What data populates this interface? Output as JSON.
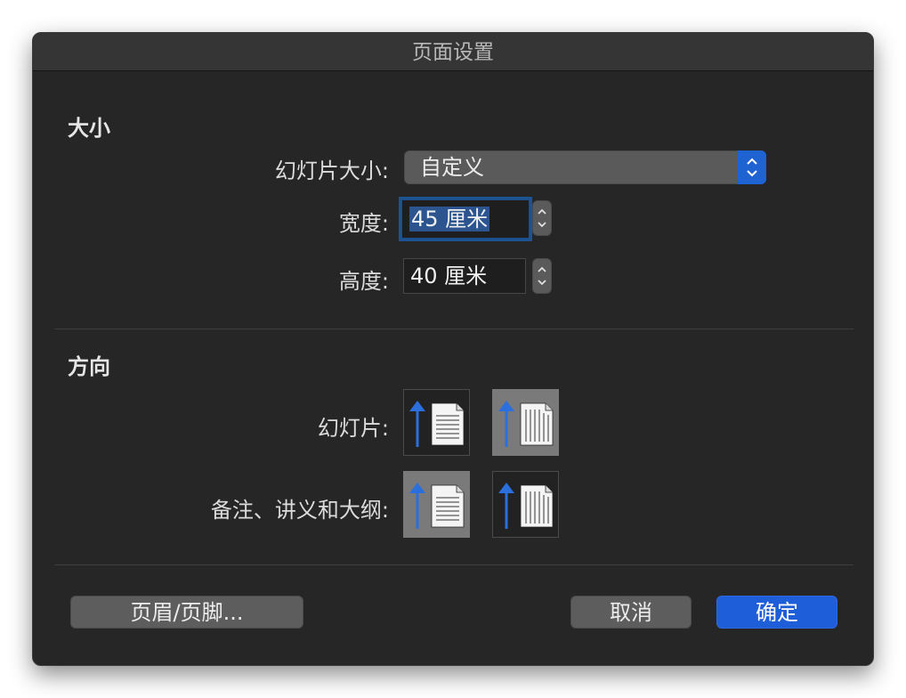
{
  "window": {
    "title": "页面设置"
  },
  "size_section": {
    "title": "大小",
    "slide_size_label": "幻灯片大小:",
    "slide_size_value": "自定义",
    "width_label": "宽度:",
    "width_value": "45 厘米",
    "height_label": "高度:",
    "height_value": "40 厘米"
  },
  "orientation_section": {
    "title": "方向",
    "slides_label": "幻灯片:",
    "notes_label": "备注、讲义和大纲:",
    "slides_selected": "landscape",
    "notes_selected": "portrait"
  },
  "buttons": {
    "header_footer": "页眉/页脚...",
    "cancel": "取消",
    "ok": "确定"
  },
  "colors": {
    "accent": "#1e5fd9",
    "dialog_bg": "#262626",
    "arrow_blue": "#2a6fdb"
  },
  "icons": {
    "portrait": "portrait-orientation-icon",
    "landscape": "landscape-orientation-icon",
    "popup_arrows": "up-down-chevron-icon",
    "stepper": "stepper-icon"
  }
}
